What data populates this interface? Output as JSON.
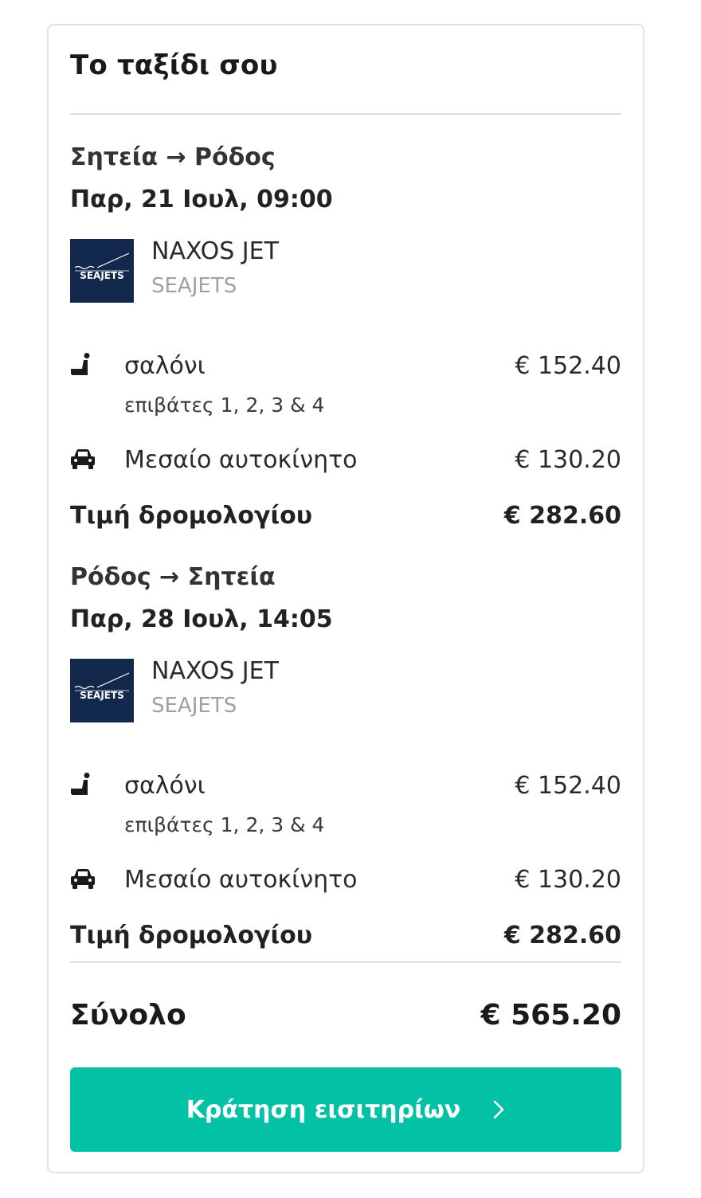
{
  "panel": {
    "title": "Το ταξίδι σου"
  },
  "legs": [
    {
      "route_from": "Σητεία",
      "route_to": "Ρόδος",
      "route": "Σητεία → Ρόδος",
      "datetime": "Παρ, 21 Ιουλ, 09:00",
      "vessel": "NAXOS JET",
      "operator": "SEAJETS",
      "logo_text": "SEAJETS",
      "seat": {
        "icon": "seat-icon",
        "label": "σαλόνι",
        "passengers": "επιβάτες 1, 2, 3 & 4",
        "price": "€ 152.40"
      },
      "vehicle": {
        "icon": "car-icon",
        "label": "Μεσαίο αυτοκίνητο",
        "price": "€ 130.20"
      },
      "subtotal_label": "Τιμή δρομολογίου",
      "subtotal_price": "€ 282.60"
    },
    {
      "route_from": "Ρόδος",
      "route_to": "Σητεία",
      "route": "Ρόδος → Σητεία",
      "datetime": "Παρ, 28 Ιουλ, 14:05",
      "vessel": "NAXOS JET",
      "operator": "SEAJETS",
      "logo_text": "SEAJETS",
      "seat": {
        "icon": "seat-icon",
        "label": "σαλόνι",
        "passengers": "επιβάτες 1, 2, 3 & 4",
        "price": "€ 152.40"
      },
      "vehicle": {
        "icon": "car-icon",
        "label": "Μεσαίο αυτοκίνητο",
        "price": "€ 130.20"
      },
      "subtotal_label": "Τιμή δρομολογίου",
      "subtotal_price": "€ 282.60"
    }
  ],
  "total": {
    "label": "Σύνολο",
    "price": "€ 565.20"
  },
  "book_button": {
    "label": "Κράτηση εισιτηρίων",
    "icon": "chevron-right-icon"
  },
  "colors": {
    "accent": "#02c1a5",
    "logo_bg": "#12284c",
    "border": "#e3e3e3"
  }
}
